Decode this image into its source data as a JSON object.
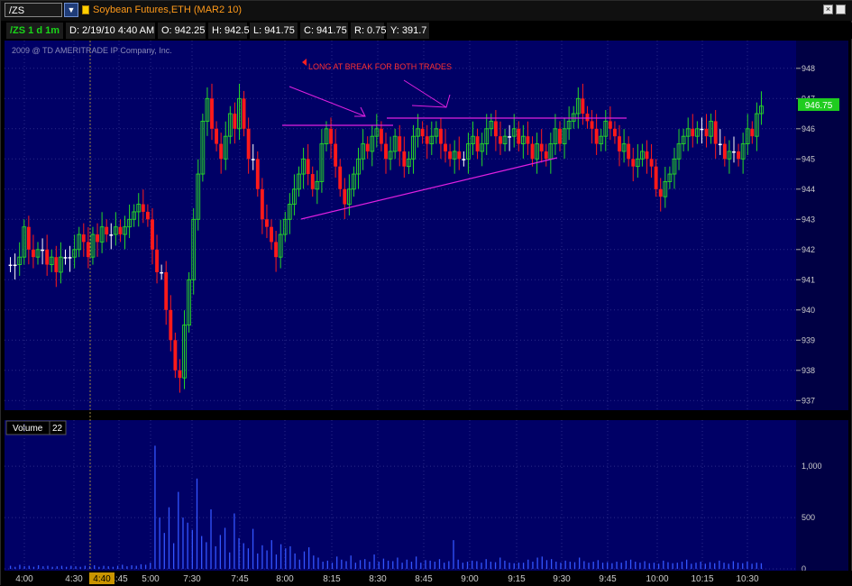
{
  "symbol_bar": {
    "symbol": "/ZS",
    "description": "Soybean Futures,ETH (MAR2 10)"
  },
  "quote_bar": {
    "chart_label": "/ZS 1 d 1m",
    "date": "D: 2/19/10 4:40 AM",
    "open": "O: 942.25",
    "high": "H: 942.5",
    "low": "L: 941.75",
    "close": "C: 941.75",
    "range": "R: 0.75",
    "y": "Y: 391.7"
  },
  "copyright": "2009 @ TD AMERITRADE IP Company, Inc.",
  "annotation": "LONG AT BREAK FOR BOTH TRADES",
  "last_price_label": "946.75",
  "volume_panel": {
    "label": "Volume",
    "value": "22"
  },
  "cursor_time_label": "4:40",
  "colors": {
    "background": "#000066",
    "grid": "#2a2a88",
    "up_bar": "#27d827",
    "down_bar": "#ff1a1a",
    "neutral_bar": "#ffffff",
    "volume_bar": "#3355ff",
    "annotation": "#e020e0",
    "annotation_text": "#ff3030",
    "axis_text": "#cccccc",
    "last_price_bg": "#1fcc1f"
  },
  "chart_data": [
    {
      "type": "candlestick",
      "title": "/ZS 1 d 1m",
      "ylim": [
        936.8,
        948.8
      ],
      "y_ticks": [
        937,
        938,
        939,
        940,
        941,
        942,
        943,
        944,
        945,
        946,
        947,
        948
      ],
      "x_ticks": [
        "4:00",
        "4:30",
        "4:45",
        "5:00",
        "7:30",
        "7:45",
        "8:00",
        "8:15",
        "8:30",
        "8:45",
        "9:00",
        "9:15",
        "9:30",
        "9:45",
        "10:00",
        "10:15",
        "10:30"
      ],
      "grid": true,
      "last_price": 946.75,
      "closes": [
        941.5,
        941.5,
        941.75,
        942.75,
        942,
        941.75,
        942,
        942,
        941.5,
        941.75,
        941.25,
        941.75,
        941.75,
        941.75,
        942,
        942.5,
        942.25,
        941.75,
        942.5,
        942.25,
        942.75,
        942.5,
        942.5,
        942.75,
        942.5,
        942.75,
        943,
        943.25,
        943.5,
        943.25,
        943,
        942,
        941.25,
        941.25,
        940,
        939,
        938,
        937.75,
        939.5,
        941,
        943,
        944.5,
        946.25,
        947,
        946,
        945.5,
        945,
        945.75,
        946.5,
        946,
        947,
        946,
        945,
        945,
        944,
        943,
        942.75,
        942.25,
        941.75,
        942.5,
        943,
        943.5,
        944,
        944.5,
        945,
        944.5,
        944,
        944.25,
        945.5,
        946,
        945.5,
        944.75,
        944,
        943.5,
        944,
        944.5,
        945,
        945.5,
        945.25,
        945.75,
        946,
        945.5,
        945,
        945.25,
        945.75,
        945.25,
        944.75,
        945,
        945.75,
        946,
        945.75,
        945.5,
        945.75,
        946,
        945.5,
        945.25,
        945,
        945.25,
        945,
        945,
        945.5,
        945.75,
        945.25,
        945.5,
        946,
        946.25,
        945.75,
        945.5,
        945.75,
        945.75,
        946,
        945.5,
        945.75,
        945.5,
        945,
        945.5,
        945.25,
        945,
        945.5,
        946,
        945.5,
        946,
        946.25,
        946.5,
        947,
        946.5,
        946.25,
        946,
        945.5,
        945.75,
        946.25,
        946,
        945.75,
        945.25,
        945.5,
        945,
        944.75,
        945,
        945.25,
        945,
        944.75,
        944,
        943.75,
        944.25,
        944.5,
        945,
        945.5,
        945.75,
        946,
        945.75,
        946,
        946,
        945.75,
        946.25,
        945.5,
        945.5,
        945,
        945.25,
        945.25,
        945,
        945.5,
        946,
        945.75,
        946.5,
        946.75
      ]
    },
    {
      "type": "bar",
      "title": "Volume",
      "ylim": [
        0,
        1300
      ],
      "y_ticks": [
        0,
        500,
        1000
      ],
      "y_tick_labels": [
        "0",
        "500",
        "1,000"
      ],
      "values": [
        30,
        20,
        40,
        25,
        30,
        20,
        35,
        25,
        30,
        20,
        25,
        30,
        20,
        30,
        25,
        20,
        30,
        25,
        35,
        20,
        30,
        25,
        20,
        30,
        40,
        25,
        35,
        30,
        45,
        40,
        60,
        1200,
        500,
        350,
        600,
        250,
        750,
        500,
        450,
        380,
        880,
        320,
        260,
        580,
        220,
        330,
        400,
        160,
        540,
        300,
        250,
        200,
        390,
        150,
        230,
        180,
        280,
        140,
        240,
        200,
        220,
        150,
        90,
        170,
        210,
        130,
        110,
        70,
        80,
        60,
        120,
        90,
        75,
        130,
        60,
        85,
        95,
        70,
        140,
        70,
        100,
        80,
        75,
        110,
        60,
        90,
        70,
        120,
        60,
        85,
        80,
        70,
        95,
        60,
        75,
        280,
        90,
        60,
        70,
        80,
        75,
        60,
        95,
        70,
        65,
        110,
        80,
        60,
        55,
        60,
        60,
        90,
        70,
        110,
        120,
        85,
        95,
        70,
        60,
        80,
        70,
        65,
        110,
        75,
        60,
        70,
        85,
        60,
        65,
        55,
        70,
        60,
        80,
        90,
        70,
        60,
        75,
        55,
        60,
        50,
        80,
        65,
        55,
        60,
        70,
        90,
        50,
        60,
        70,
        50,
        65,
        55,
        80,
        60,
        50,
        75,
        60,
        55,
        70,
        50,
        60,
        55
      ]
    }
  ]
}
